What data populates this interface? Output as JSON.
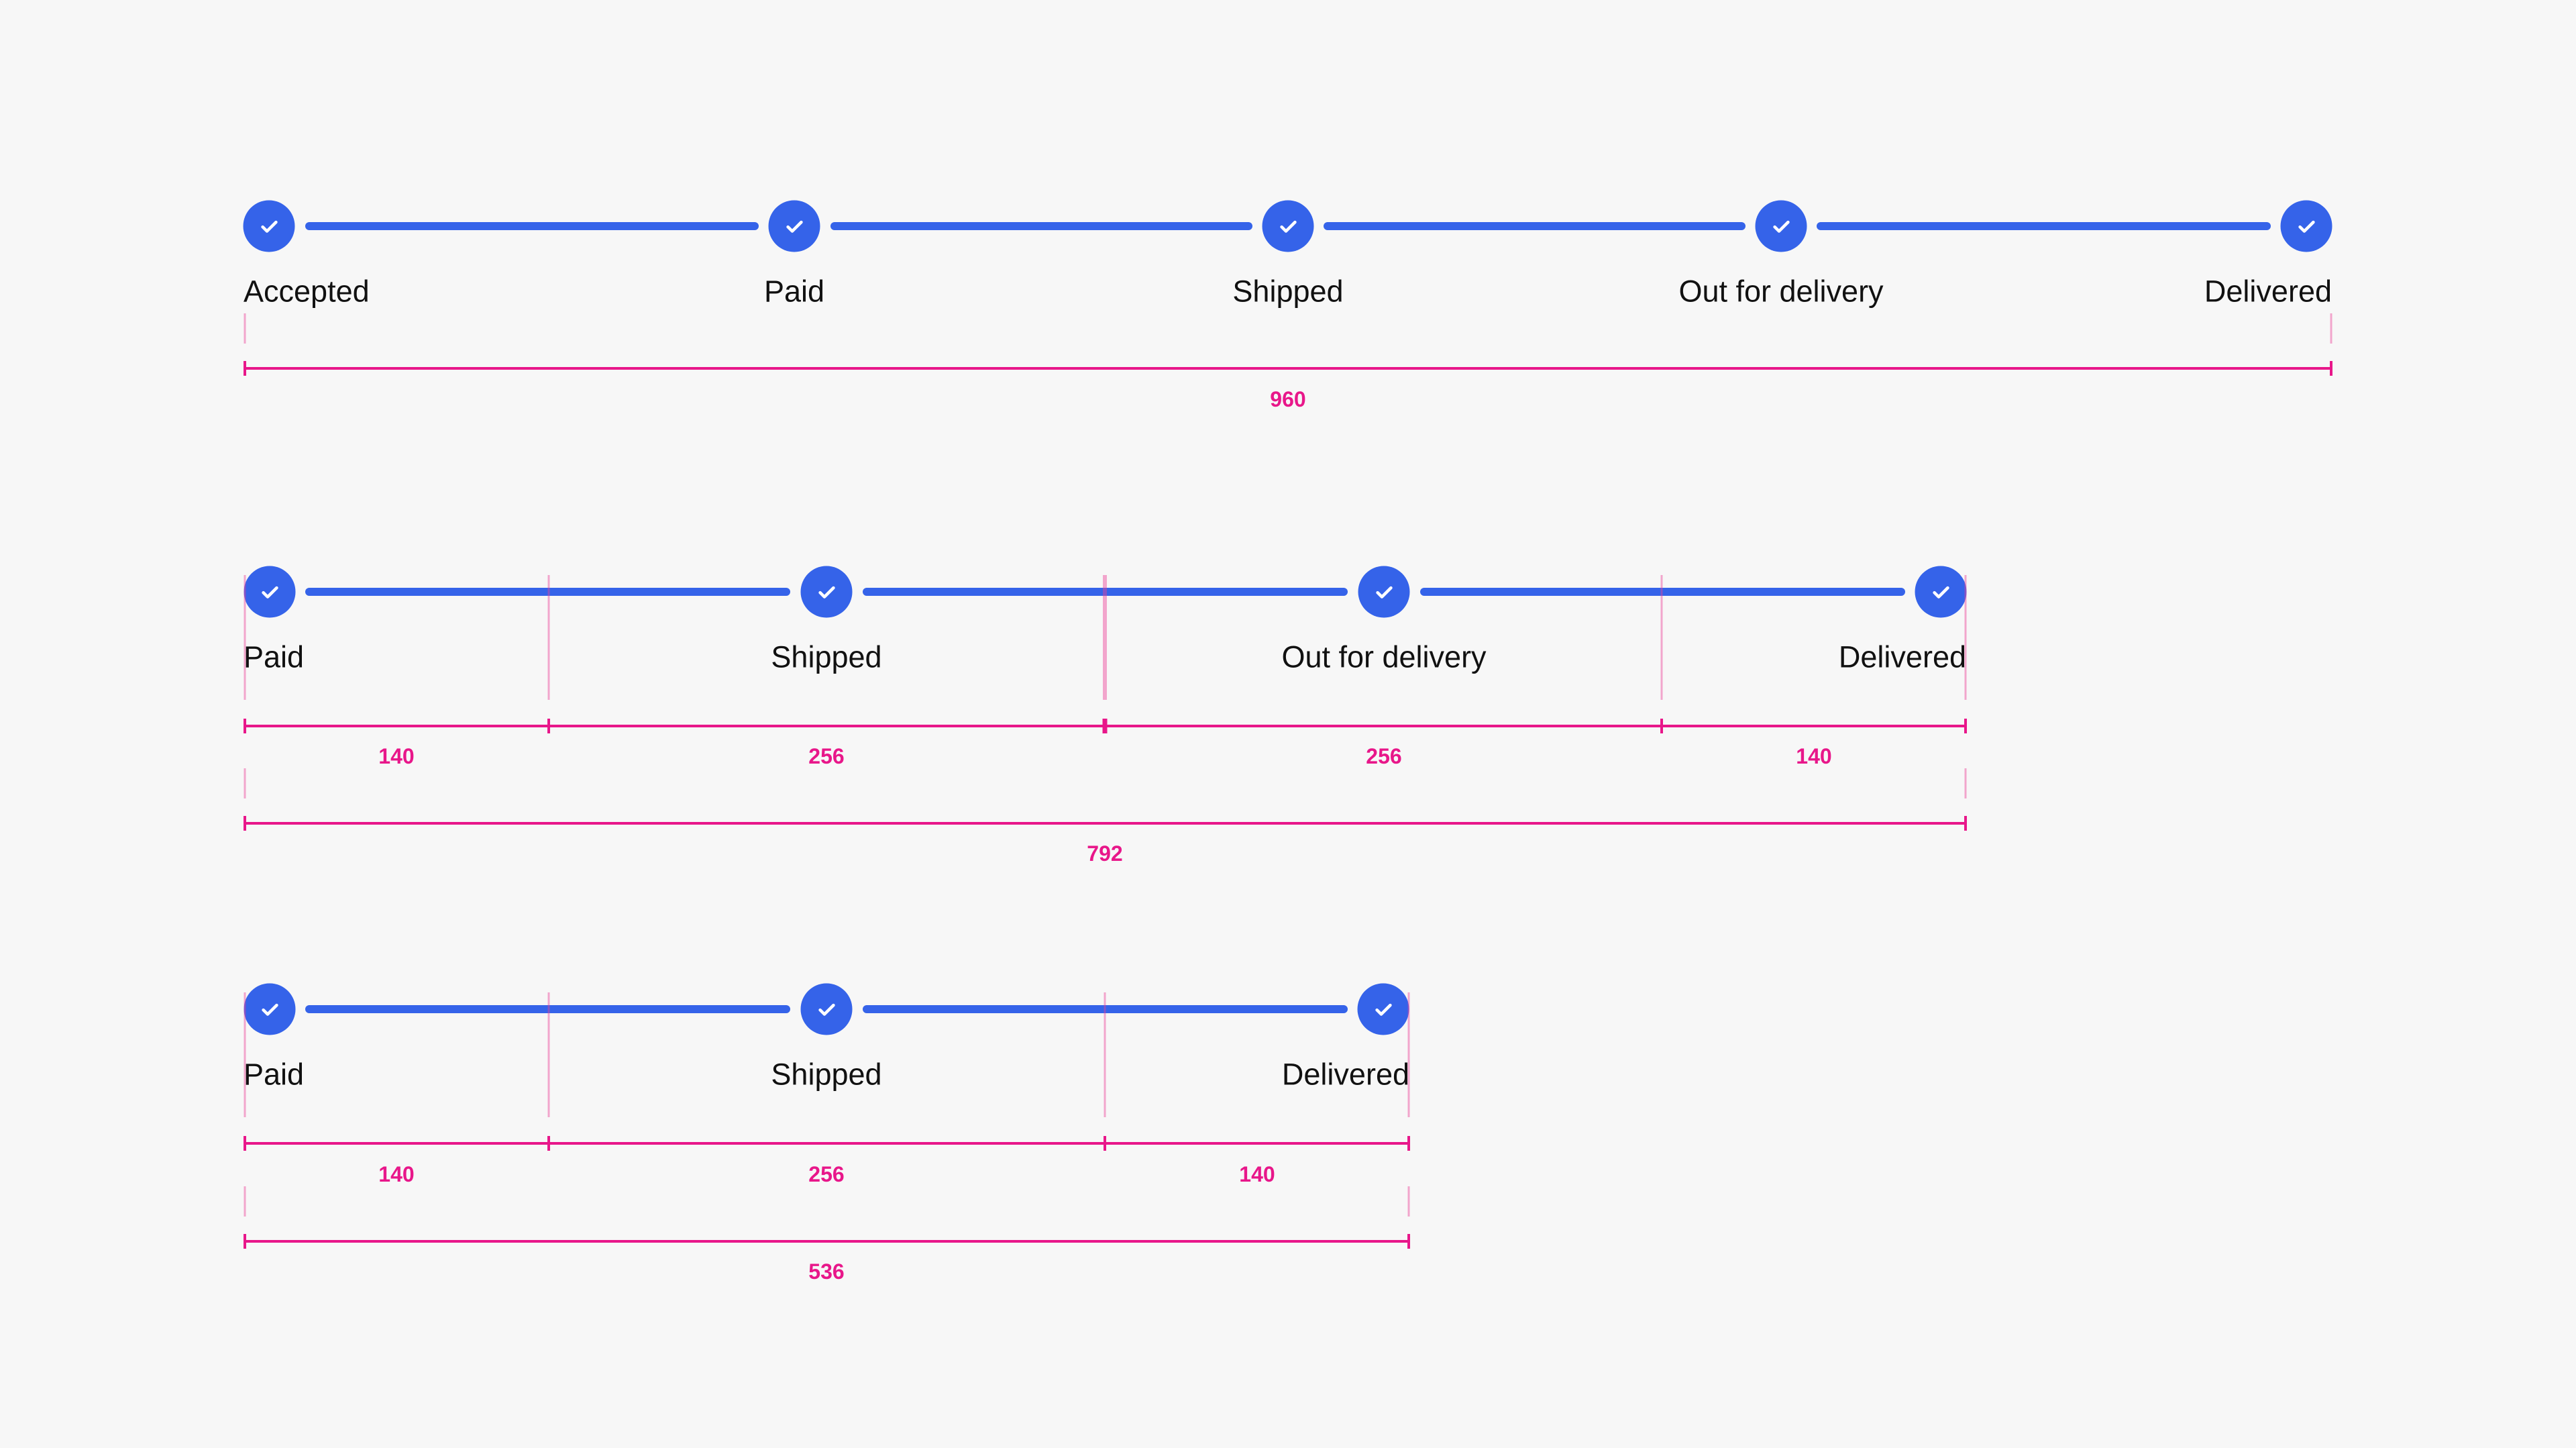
{
  "colors": {
    "background": "#f7f7f7",
    "step_complete": "#3563e9",
    "check": "#ffffff",
    "label_text": "#111111",
    "measurement": "#e8178a"
  },
  "variants": [
    {
      "name": "five-step",
      "steps": [
        {
          "label": "Accepted",
          "status": "complete",
          "icon": "check-icon"
        },
        {
          "label": "Paid",
          "status": "complete",
          "icon": "check-icon"
        },
        {
          "label": "Shipped",
          "status": "complete",
          "icon": "check-icon"
        },
        {
          "label": "Out for delivery",
          "status": "complete",
          "icon": "check-icon"
        },
        {
          "label": "Delivered",
          "status": "complete",
          "icon": "check-icon"
        }
      ],
      "segment_widths": [],
      "total_width": "960"
    },
    {
      "name": "four-step",
      "steps": [
        {
          "label": "Paid",
          "status": "complete",
          "icon": "check-icon"
        },
        {
          "label": "Shipped",
          "status": "complete",
          "icon": "check-icon"
        },
        {
          "label": "Out for delivery",
          "status": "complete",
          "icon": "check-icon"
        },
        {
          "label": "Delivered",
          "status": "complete",
          "icon": "check-icon"
        }
      ],
      "segment_widths": [
        "140",
        "256",
        "256",
        "140"
      ],
      "total_width": "792"
    },
    {
      "name": "three-step",
      "steps": [
        {
          "label": "Paid",
          "status": "complete",
          "icon": "check-icon"
        },
        {
          "label": "Shipped",
          "status": "complete",
          "icon": "check-icon"
        },
        {
          "label": "Delivered",
          "status": "complete",
          "icon": "check-icon"
        }
      ],
      "segment_widths": [
        "140",
        "256",
        "140"
      ],
      "total_width": "536"
    }
  ]
}
